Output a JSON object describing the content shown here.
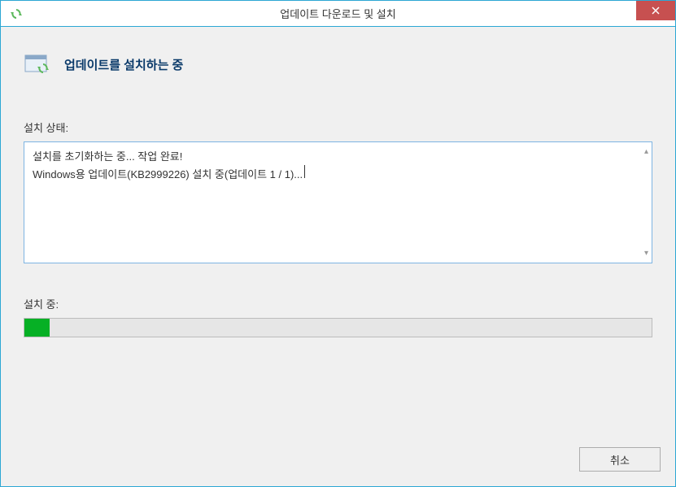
{
  "window": {
    "title": "업데이트 다운로드 및 설치"
  },
  "header": {
    "title": "업데이트를 설치하는 중"
  },
  "status": {
    "label": "설치 상태:",
    "line1": "설치를 초기화하는 중... 작업 완료!",
    "line2": "Windows용 업데이트(KB2999226) 설치 중(업데이트 1 / 1)..."
  },
  "progress": {
    "label": "설치 중:",
    "percent": 4
  },
  "buttons": {
    "cancel": "취소"
  }
}
